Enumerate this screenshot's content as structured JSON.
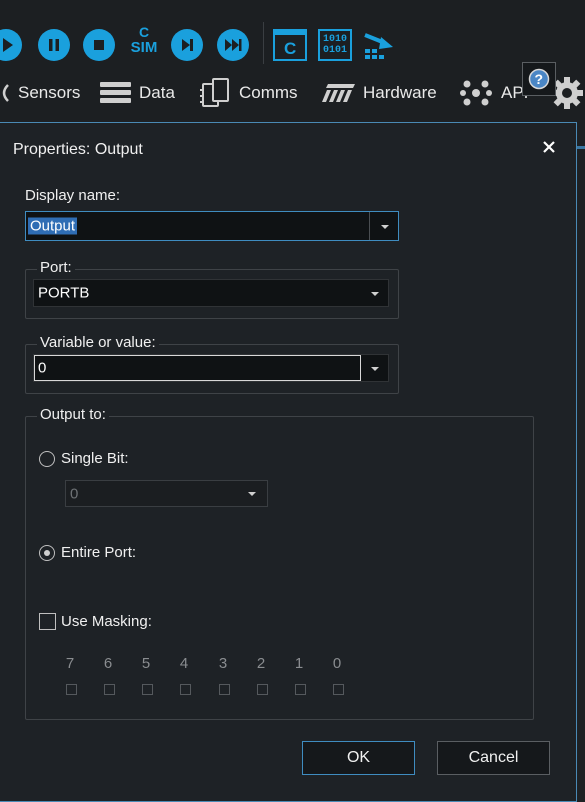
{
  "toolbar": {
    "icons": [
      "play-icon",
      "pause-icon",
      "stop-icon",
      "c-sim-icon",
      "step-icon",
      "fast-forward-icon",
      "c-code-icon",
      "binary-icon",
      "download-icon"
    ],
    "c_sim_top": "C",
    "c_sim_bottom": "SIM",
    "binary_top": "1010",
    "binary_bottom": "0101"
  },
  "menu": {
    "items": [
      {
        "label": "Sensors"
      },
      {
        "label": "Data"
      },
      {
        "label": "Comms"
      },
      {
        "label": "Hardware"
      },
      {
        "label": "API"
      }
    ]
  },
  "dialog": {
    "title": "Properties: Output",
    "display_name_label": "Display name:",
    "display_name_value": "Output",
    "port_label": "Port:",
    "port_value": "PORTB",
    "variable_label": "Variable or value:",
    "variable_value": "0",
    "output_to_label": "Output to:",
    "single_bit_label": "Single Bit:",
    "single_bit_value": "0",
    "entire_port_label": "Entire Port:",
    "use_masking_label": "Use Masking:",
    "bits": [
      "7",
      "6",
      "5",
      "4",
      "3",
      "2",
      "1",
      "0"
    ],
    "ok_label": "OK",
    "cancel_label": "Cancel",
    "selected_output": "Entire Port"
  },
  "colors": {
    "accent": "#1aa0dd",
    "dialog_border": "#4a8ab5",
    "background": "#1e2226"
  }
}
